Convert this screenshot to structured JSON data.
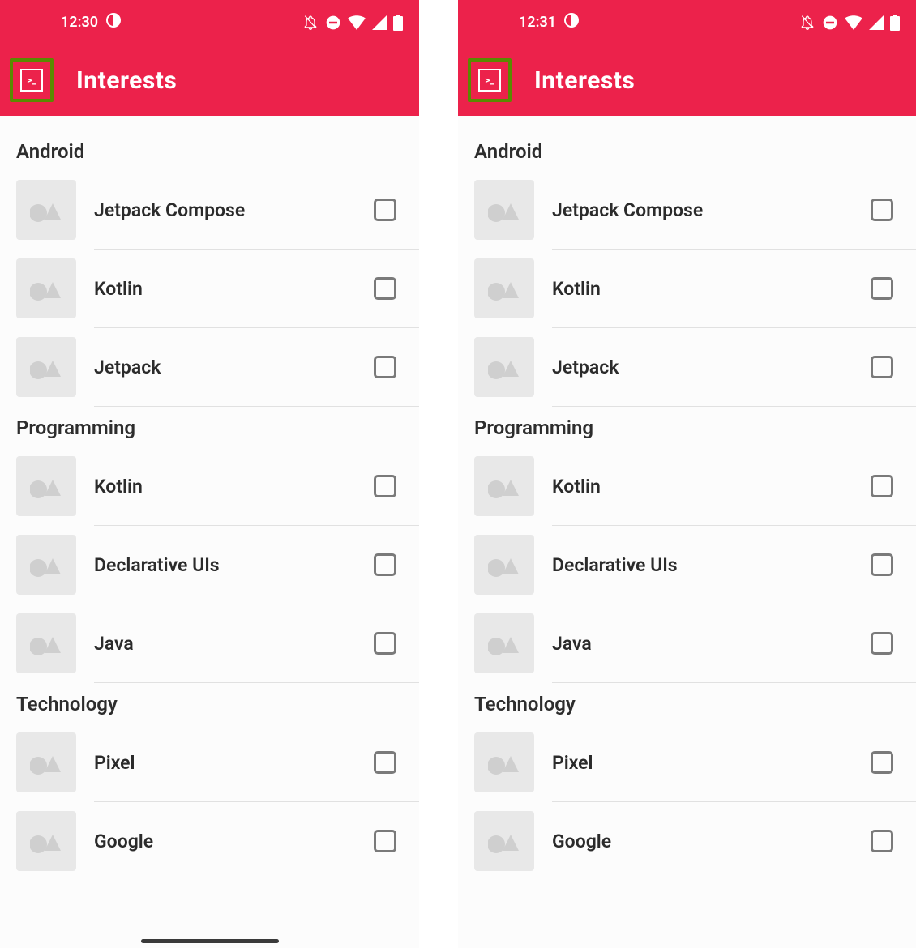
{
  "screens": [
    {
      "statusTime": "12:30",
      "appTitle": "Interests",
      "sections": [
        {
          "title": "Android",
          "items": [
            {
              "label": "Jetpack Compose",
              "checked": false
            },
            {
              "label": "Kotlin",
              "checked": false
            },
            {
              "label": "Jetpack",
              "checked": false
            }
          ]
        },
        {
          "title": "Programming",
          "items": [
            {
              "label": "Kotlin",
              "checked": false
            },
            {
              "label": "Declarative UIs",
              "checked": false
            },
            {
              "label": "Java",
              "checked": false
            }
          ]
        },
        {
          "title": "Technology",
          "items": [
            {
              "label": "Pixel",
              "checked": false
            },
            {
              "label": "Google",
              "checked": false
            }
          ]
        }
      ]
    },
    {
      "statusTime": "12:31",
      "appTitle": "Interests",
      "sections": [
        {
          "title": "Android",
          "items": [
            {
              "label": "Jetpack Compose",
              "checked": false
            },
            {
              "label": "Kotlin",
              "checked": false
            },
            {
              "label": "Jetpack",
              "checked": false
            }
          ]
        },
        {
          "title": "Programming",
          "items": [
            {
              "label": "Kotlin",
              "checked": false
            },
            {
              "label": "Declarative UIs",
              "checked": false
            },
            {
              "label": "Java",
              "checked": false
            }
          ]
        },
        {
          "title": "Technology",
          "items": [
            {
              "label": "Pixel",
              "checked": false
            },
            {
              "label": "Google",
              "checked": false
            }
          ]
        }
      ]
    }
  ]
}
